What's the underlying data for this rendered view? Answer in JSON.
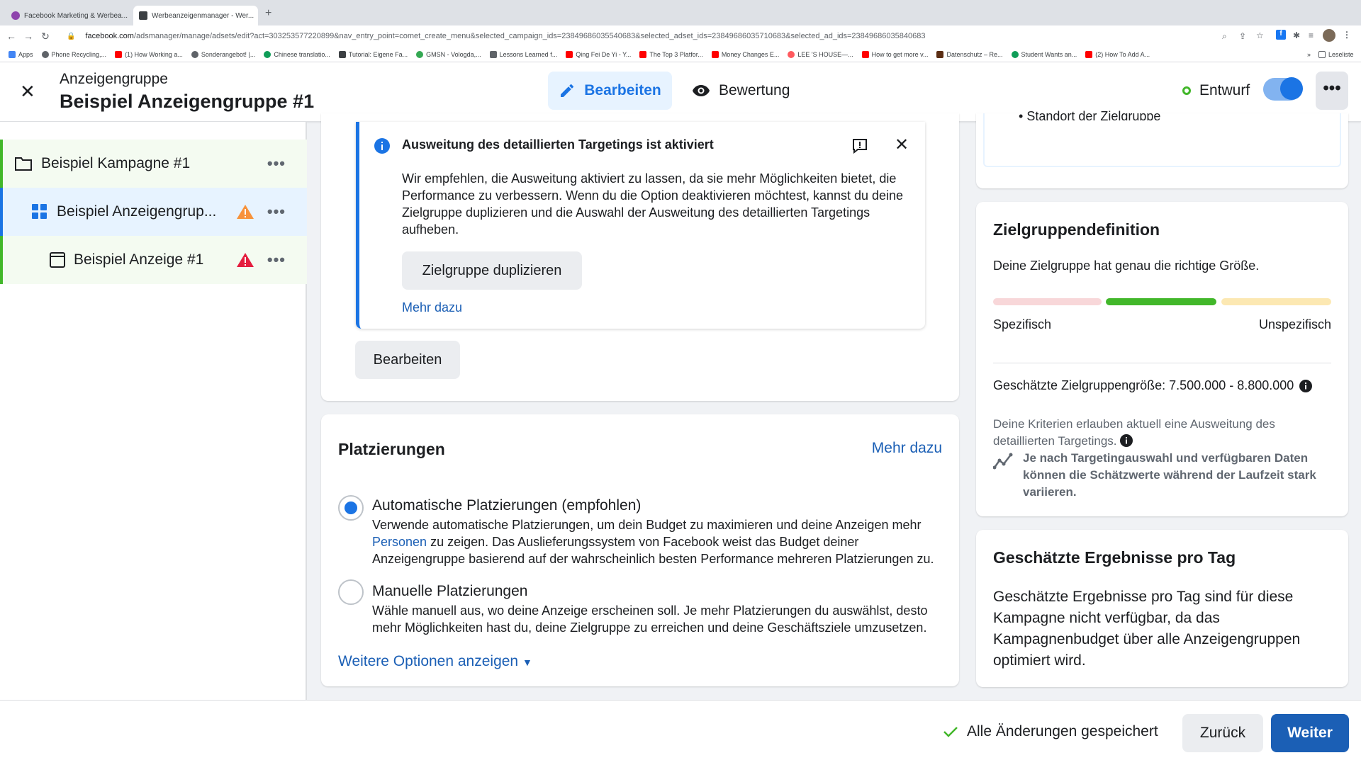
{
  "browser": {
    "tabs": [
      {
        "label": "Facebook Marketing & Werbea..."
      },
      {
        "label": "Werbeanzeigenmanager - Wer..."
      }
    ],
    "url_host": "facebook.com",
    "url_path": "/adsmanager/manage/adsets/edit?act=303253577220899&nav_entry_point=comet_create_menu&selected_campaign_ids=23849686035540683&selected_adset_ids=23849686035710683&selected_ad_ids=23849686035840683",
    "bookmarks": [
      "Apps",
      "Phone Recycling,...",
      "(1) How Working a...",
      "Sonderangebot! |...",
      "Chinese translatio...",
      "Tutorial: Eigene Fa...",
      "GMSN - Vologda,...",
      "Lessons Learned f...",
      "Qing Fei De Yi - Y...",
      "The Top 3 Platfor...",
      "Money Changes E...",
      "LEE 'S HOUSE—...",
      "How to get more v...",
      "Datenschutz – Re...",
      "Student Wants an...",
      "(2) How To Add A..."
    ],
    "reading_list": "Leseliste"
  },
  "header": {
    "subtitle": "Anzeigengruppe",
    "title": "Beispiel Anzeigengruppe #1",
    "edit_label": "Bearbeiten",
    "review_label": "Bewertung",
    "status_label": "Entwurf"
  },
  "sidebar": {
    "items": [
      {
        "label": "Beispiel Kampagne #1"
      },
      {
        "label": "Beispiel Anzeigengrup..."
      },
      {
        "label": "Beispiel Anzeige #1"
      }
    ]
  },
  "info_box": {
    "title": "Ausweitung des detaillierten Targetings ist aktiviert",
    "body": "Wir empfehlen, die Ausweitung aktiviert zu lassen, da sie mehr Möglichkeiten bietet, die Performance zu verbessern. Wenn du die Option deaktivieren möchtest, kannst du deine Zielgruppe duplizieren und die Auswahl der Ausweitung des detaillierten Targetings aufheben.",
    "duplicate_label": "Zielgruppe duplizieren",
    "more_label": "Mehr dazu"
  },
  "edit_button_label": "Bearbeiten",
  "placements": {
    "title": "Platzierungen",
    "more_label": "Mehr dazu",
    "options": [
      {
        "label": "Automatische Platzierungen (empfohlen)",
        "desc_a": "Verwende automatische Platzierungen, um dein Budget zu maximieren und deine Anzeigen mehr ",
        "desc_link": "Personen",
        "desc_b": " zu zeigen. Das Auslieferungssystem von Facebook weist das Budget deiner Anzeigengruppe basierend auf der wahrscheinlich besten Performance mehreren Platzierungen zu.",
        "selected": true
      },
      {
        "label": "Manuelle Platzierungen",
        "desc": "Wähle manuell aus, wo deine Anzeige erscheinen soll. Je mehr Platzierungen du auswählst, desto mehr Möglichkeiten hast du, deine Zielgruppe zu erreichen und deine Geschäftsziele umzusetzen.",
        "selected": false
      }
    ],
    "more_options_label": "Weitere Optionen anzeigen"
  },
  "audience_summary": {
    "partial_item": "Standort der Zielgruppe"
  },
  "audience_definition": {
    "title": "Zielgruppendefinition",
    "status": "Deine Zielgruppe hat genau die richtige Größe.",
    "left_label": "Spezifisch",
    "right_label": "Unspezifisch",
    "size_text": "Geschätzte Zielgruppengröße: 7.500.000 - 8.800.000",
    "criteria_text": "Deine Kriterien erlauben aktuell eine Ausweitung des detaillierten Targetings.",
    "note": "Je nach Targetingauswahl und verfügbaren Daten können die Schätzwerte während der Laufzeit stark variieren.",
    "colors": {
      "left": "#f8d7d9",
      "mid": "#42b72a",
      "right": "#fce8b2"
    }
  },
  "results": {
    "title": "Geschätzte Ergebnisse pro Tag",
    "text": "Geschätzte Ergebnisse pro Tag sind für diese Kampagne nicht verfügbar, da das Kampagnenbudget über alle Anzeigengruppen optimiert wird."
  },
  "footer": {
    "saved_label": "Alle Änderungen gespeichert",
    "back_label": "Zurück",
    "next_label": "Weiter"
  },
  "colors": {
    "accent": "#1b74e4",
    "link": "#1b5fb5",
    "success": "#42b72a",
    "warning_orange": "#f7923b",
    "warning_red": "#e41e3f"
  }
}
